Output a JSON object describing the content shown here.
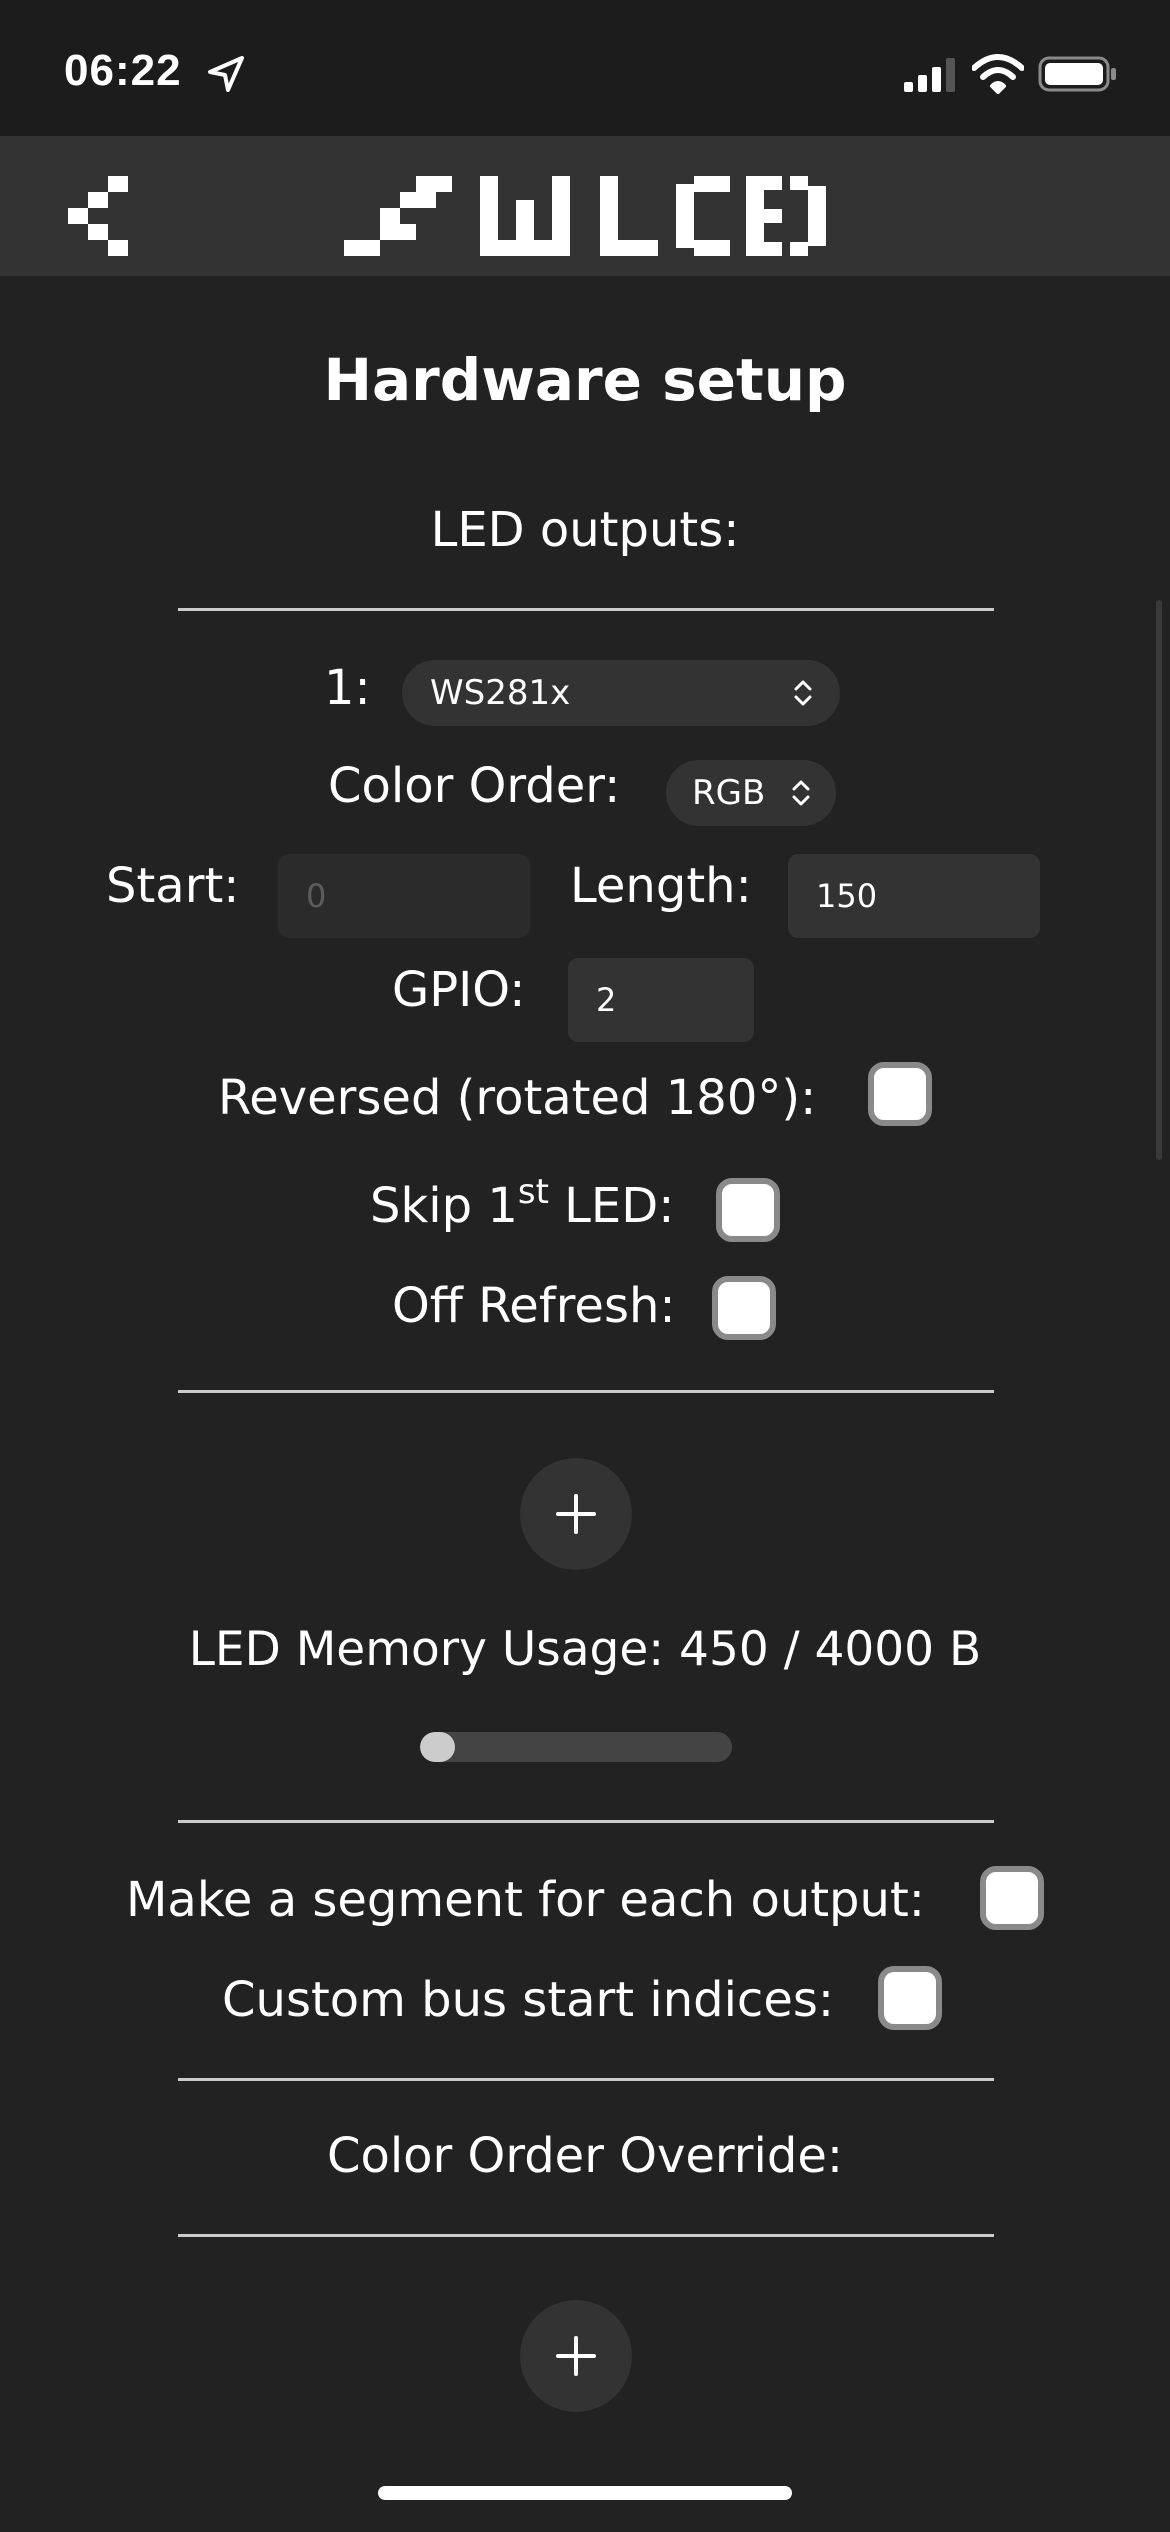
{
  "status_bar": {
    "time": "06:22",
    "icons": [
      "location-arrow-icon",
      "cellular-signal-icon",
      "wifi-icon",
      "battery-icon"
    ]
  },
  "header": {
    "back_icon": "chevron-left-icon",
    "logo": "WLED"
  },
  "page": {
    "title": "Hardware setup"
  },
  "led_outputs": {
    "section_label": "LED outputs:",
    "outputs": [
      {
        "index_label": "1:",
        "type": "WS281x",
        "color_order_label": "Color Order:",
        "color_order": "RGB",
        "start_label": "Start:",
        "start_value": "0",
        "length_label": "Length:",
        "length_value": "150",
        "gpio_label": "GPIO:",
        "gpio_value": "2",
        "reversed_label": "Reversed (rotated 180°):",
        "reversed_checked": false,
        "skip_label_pre": "Skip 1",
        "skip_label_sup": "st",
        "skip_label_post": " LED:",
        "skip_checked": false,
        "off_refresh_label": "Off Refresh:",
        "off_refresh_checked": false
      }
    ],
    "add_output_icon": "plus-icon"
  },
  "memory": {
    "label": "LED Memory Usage: 450 / 4000 B",
    "used": 450,
    "total": 4000
  },
  "options": {
    "segment_per_output_label": "Make a segment for each output:",
    "segment_per_output_checked": false,
    "custom_bus_start_label": "Custom bus start indices:",
    "custom_bus_start_checked": false
  },
  "color_order_override": {
    "label": "Color Order Override:",
    "add_icon": "plus-icon"
  },
  "colors": {
    "background": "#222222",
    "header": "#333333",
    "control": "#333333",
    "text": "#ffffff",
    "checkbox_border": "#8a8a8a"
  }
}
